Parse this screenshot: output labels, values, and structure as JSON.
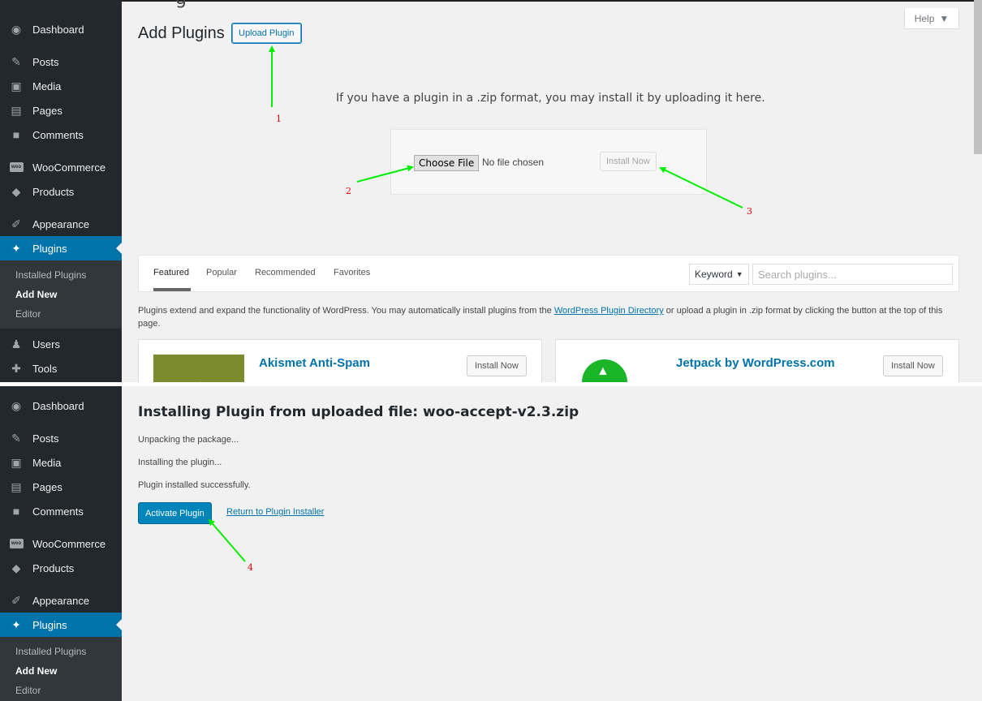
{
  "caption_cut": "g",
  "sidebar": {
    "items": [
      {
        "label": "Dashboard",
        "icon": "dashboard-icon"
      },
      {
        "label": "Posts",
        "icon": "pin-icon"
      },
      {
        "label": "Media",
        "icon": "media-icon"
      },
      {
        "label": "Pages",
        "icon": "pages-icon"
      },
      {
        "label": "Comments",
        "icon": "comment-icon"
      },
      {
        "label": "WooCommerce",
        "icon": "woocommerce-icon"
      },
      {
        "label": "Products",
        "icon": "products-icon"
      },
      {
        "label": "Appearance",
        "icon": "paintbrush-icon"
      },
      {
        "label": "Plugins",
        "icon": "plugin-icon"
      },
      {
        "label": "Users",
        "icon": "users-icon"
      },
      {
        "label": "Tools",
        "icon": "wrench-icon"
      }
    ],
    "submenu": [
      "Installed Plugins",
      "Add New",
      "Editor"
    ]
  },
  "screen1": {
    "title": "Add Plugins",
    "upload_button": "Upload Plugin",
    "help": "Help",
    "upload_help_text": "If you have a plugin in a .zip format, you may install it by uploading it here.",
    "choose_file_label": "Choose File",
    "no_file_text": "No file chosen",
    "install_now_disabled": "Install Now",
    "tabs": [
      "Featured",
      "Popular",
      "Recommended",
      "Favorites"
    ],
    "keyword_select": "Keyword",
    "search_placeholder": "Search plugins...",
    "desc_before": "Plugins extend and expand the functionality of WordPress. You may automatically install plugins from the ",
    "desc_link": "WordPress Plugin Directory",
    "desc_after": " or upload a plugin in .zip format by clicking the button at the top of this page.",
    "cards": [
      {
        "title": "Akismet Anti-Spam",
        "button": "Install Now"
      },
      {
        "title": "Jetpack by WordPress.com",
        "button": "Install Now"
      }
    ]
  },
  "screen2": {
    "title": "Installing Plugin from uploaded file: woo-accept-v2.3.zip",
    "steps": [
      "Unpacking the package...",
      "Installing the plugin...",
      "Plugin installed successfully."
    ],
    "activate_button": "Activate Plugin",
    "return_link": "Return to Plugin Installer"
  },
  "annotations": [
    "1",
    "2",
    "3",
    "4"
  ],
  "colors": {
    "sidebar_bg": "#23282d",
    "submenu_bg": "#32373c",
    "active_blue": "#0073aa",
    "primary_button": "#0085ba",
    "arrow_green": "#00ee00",
    "annotation_red": "#e00000",
    "akismet_green": "#7b8b2e",
    "jetpack_green": "#1bb627"
  }
}
